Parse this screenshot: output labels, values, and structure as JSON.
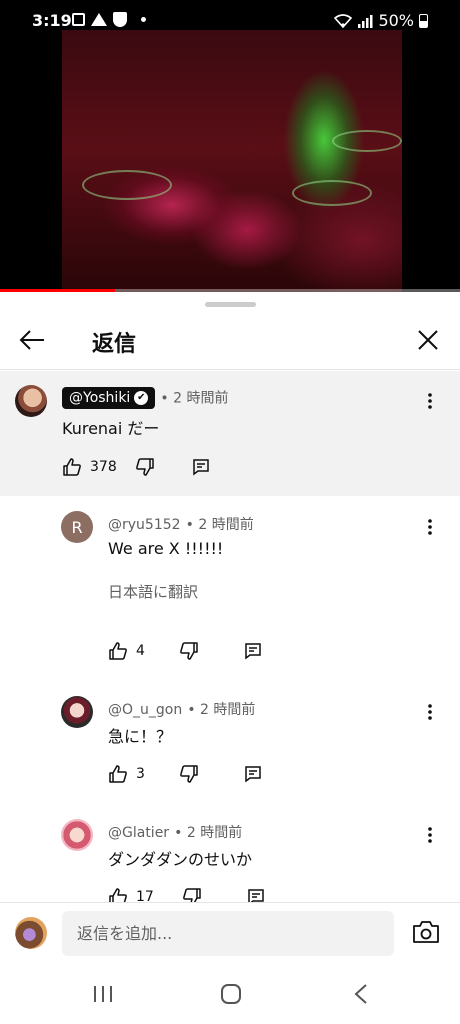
{
  "status_bar": {
    "time": "3:19",
    "battery": "50%"
  },
  "video": {
    "progress_fraction": 0.25
  },
  "sheet": {
    "title": "返信"
  },
  "parent_comment": {
    "author": "@Yoshiki",
    "time": "• 2 時間前",
    "text": "Kurenai だー",
    "likes": "378"
  },
  "replies": [
    {
      "avatar_letter": "R",
      "author": "@ryu5152",
      "time": "• 2 時間前",
      "text": "We are X !!!!!!",
      "translate": "日本語に翻訳",
      "likes": "4"
    },
    {
      "author": "@O_u_gon",
      "time": "• 2 時間前",
      "text": "急に！？",
      "likes": "3"
    },
    {
      "author": "@Glatier",
      "time": "• 2 時間前",
      "text": "ダンダダンのせいか",
      "likes": "17"
    }
  ],
  "composer": {
    "placeholder": "返信を追加..."
  },
  "icons": {
    "back": "arrow-left-icon",
    "close": "close-icon",
    "more": "more-vert-icon",
    "like": "thumb-up-icon",
    "dislike": "thumb-down-icon",
    "reply": "reply-icon",
    "camera": "camera-icon"
  },
  "colors": {
    "accent": "#ff0000",
    "text": "#0f0f0f",
    "secondary": "#606060",
    "highlight_bg": "#f2f2f2"
  }
}
